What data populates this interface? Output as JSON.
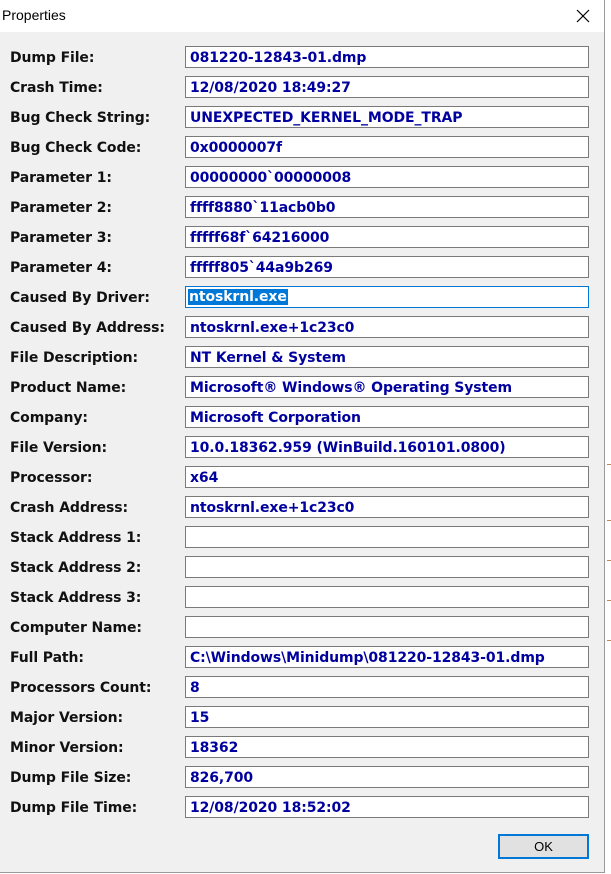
{
  "window": {
    "title": "Properties",
    "ok_label": "OK"
  },
  "fields": [
    {
      "label": "Dump File:",
      "value": "081220-12843-01.dmp"
    },
    {
      "label": "Crash Time:",
      "value": "12/08/2020 18:49:27"
    },
    {
      "label": "Bug Check String:",
      "value": "UNEXPECTED_KERNEL_MODE_TRAP"
    },
    {
      "label": "Bug Check Code:",
      "value": "0x0000007f"
    },
    {
      "label": "Parameter 1:",
      "value": "00000000`00000008"
    },
    {
      "label": "Parameter 2:",
      "value": "ffff8880`11acb0b0"
    },
    {
      "label": "Parameter 3:",
      "value": "fffff68f`64216000"
    },
    {
      "label": "Parameter 4:",
      "value": "fffff805`44a9b269"
    },
    {
      "label": "Caused By Driver:",
      "value": "ntoskrnl.exe"
    },
    {
      "label": "Caused By Address:",
      "value": "ntoskrnl.exe+1c23c0"
    },
    {
      "label": "File Description:",
      "value": "NT Kernel & System"
    },
    {
      "label": "Product Name:",
      "value": "Microsoft® Windows® Operating System"
    },
    {
      "label": "Company:",
      "value": "Microsoft Corporation"
    },
    {
      "label": "File Version:",
      "value": "10.0.18362.959 (WinBuild.160101.0800)"
    },
    {
      "label": "Processor:",
      "value": "x64"
    },
    {
      "label": "Crash Address:",
      "value": "ntoskrnl.exe+1c23c0"
    },
    {
      "label": "Stack Address 1:",
      "value": ""
    },
    {
      "label": "Stack Address 2:",
      "value": ""
    },
    {
      "label": "Stack Address 3:",
      "value": ""
    },
    {
      "label": "Computer Name:",
      "value": ""
    },
    {
      "label": "Full Path:",
      "value": "C:\\Windows\\Minidump\\081220-12843-01.dmp"
    },
    {
      "label": "Processors Count:",
      "value": "8"
    },
    {
      "label": "Major Version:",
      "value": "15"
    },
    {
      "label": "Minor Version:",
      "value": "18362"
    },
    {
      "label": "Dump File Size:",
      "value": "826,700"
    },
    {
      "label": "Dump File Time:",
      "value": "12/08/2020 18:52:02"
    }
  ],
  "icons": {
    "close": "close-icon"
  }
}
